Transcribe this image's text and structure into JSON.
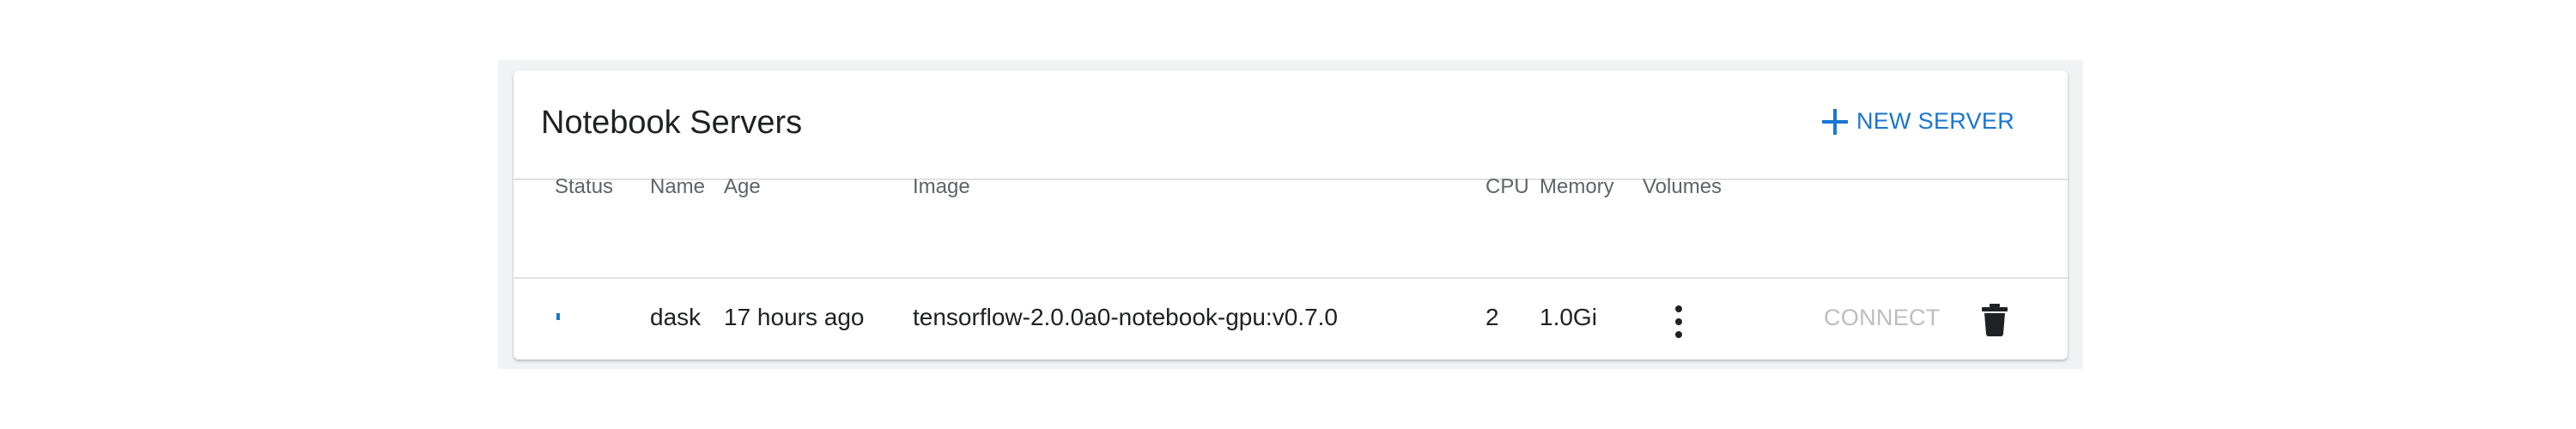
{
  "card": {
    "title": "Notebook Servers",
    "new_server_label": "NEW SERVER",
    "new_server_icon": "plus-icon",
    "accent_color": "#1976d2"
  },
  "table": {
    "columns": [
      "Status",
      "Name",
      "Age",
      "Image",
      "CPU",
      "Memory",
      "Volumes"
    ],
    "rows": [
      {
        "status_icon": "status-indicator",
        "name": "dask",
        "age": "17 hours ago",
        "image": "tensorflow-2.0.0a0-notebook-gpu:v0.7.0",
        "cpu": "2",
        "memory": "1.0Gi",
        "volumes_icon": "more-vert-icon",
        "connect_label": "CONNECT",
        "delete_icon": "trash-icon"
      }
    ]
  }
}
